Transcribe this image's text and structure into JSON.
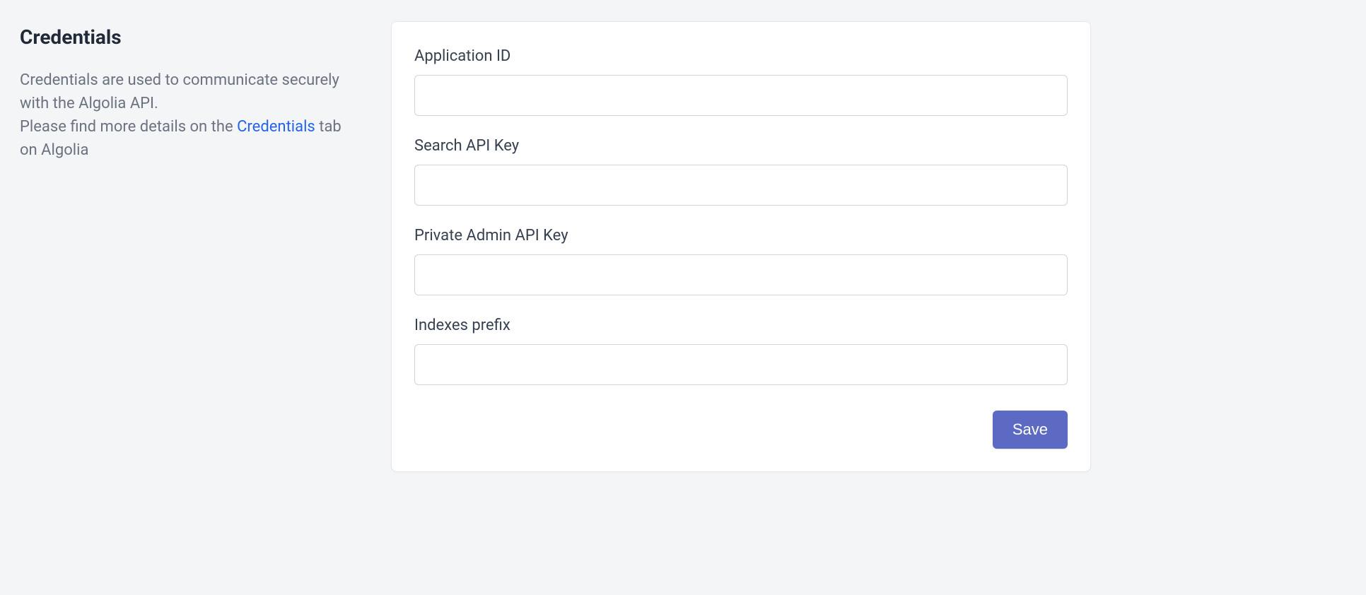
{
  "sidebar": {
    "heading": "Credentials",
    "description_part1": "Credentials are used to communicate securely with the Algolia API.",
    "description_part2a": "Please find more details on the ",
    "description_link": "Credentials",
    "description_part2b": " tab on Algolia"
  },
  "form": {
    "application_id": {
      "label": "Application ID",
      "value": ""
    },
    "search_api_key": {
      "label": "Search API Key",
      "value": ""
    },
    "private_admin_api_key": {
      "label": "Private Admin API Key",
      "value": ""
    },
    "indexes_prefix": {
      "label": "Indexes prefix",
      "value": ""
    },
    "save_label": "Save"
  }
}
